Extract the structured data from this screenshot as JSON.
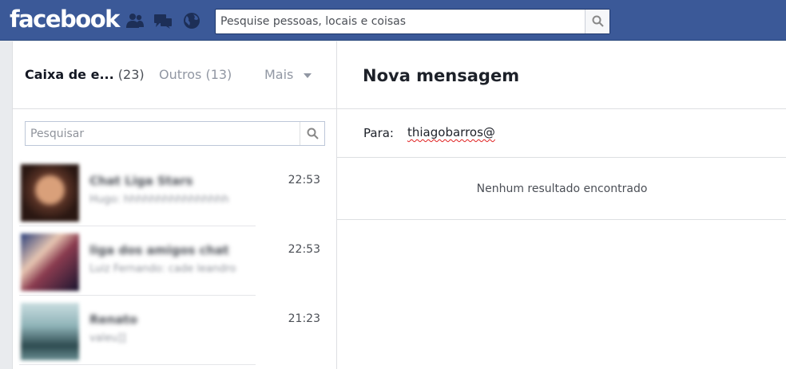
{
  "header": {
    "logo": "facebook",
    "search_placeholder": "Pesquise pessoas, locais e coisas",
    "jewels": [
      "friends-icon",
      "messages-icon",
      "notifications-globe-icon"
    ],
    "colors": {
      "brand": "#3b5998"
    }
  },
  "inbox": {
    "tabs": [
      {
        "label": "Caixa de e...",
        "count": "(23)"
      },
      {
        "label": "Outros",
        "count": "(13)"
      },
      {
        "label": "Mais"
      }
    ],
    "search_placeholder": "Pesquisar",
    "threads": [
      {
        "name": "Chat Liga Stars",
        "snippet": "Hugo: hhhhhhhhhhhhhhhh",
        "time": "22:53"
      },
      {
        "name": "liga dos amigos chat",
        "snippet": "Luiz Fernando: cade leandro",
        "time": "22:53"
      },
      {
        "name": "Renato",
        "snippet": "valeu]]",
        "time": "21:23"
      }
    ]
  },
  "compose": {
    "title": "Nova mensagem",
    "to_label": "Para:",
    "to_value": "thiagobarros@",
    "no_results": "Nenhum resultado encontrado"
  }
}
